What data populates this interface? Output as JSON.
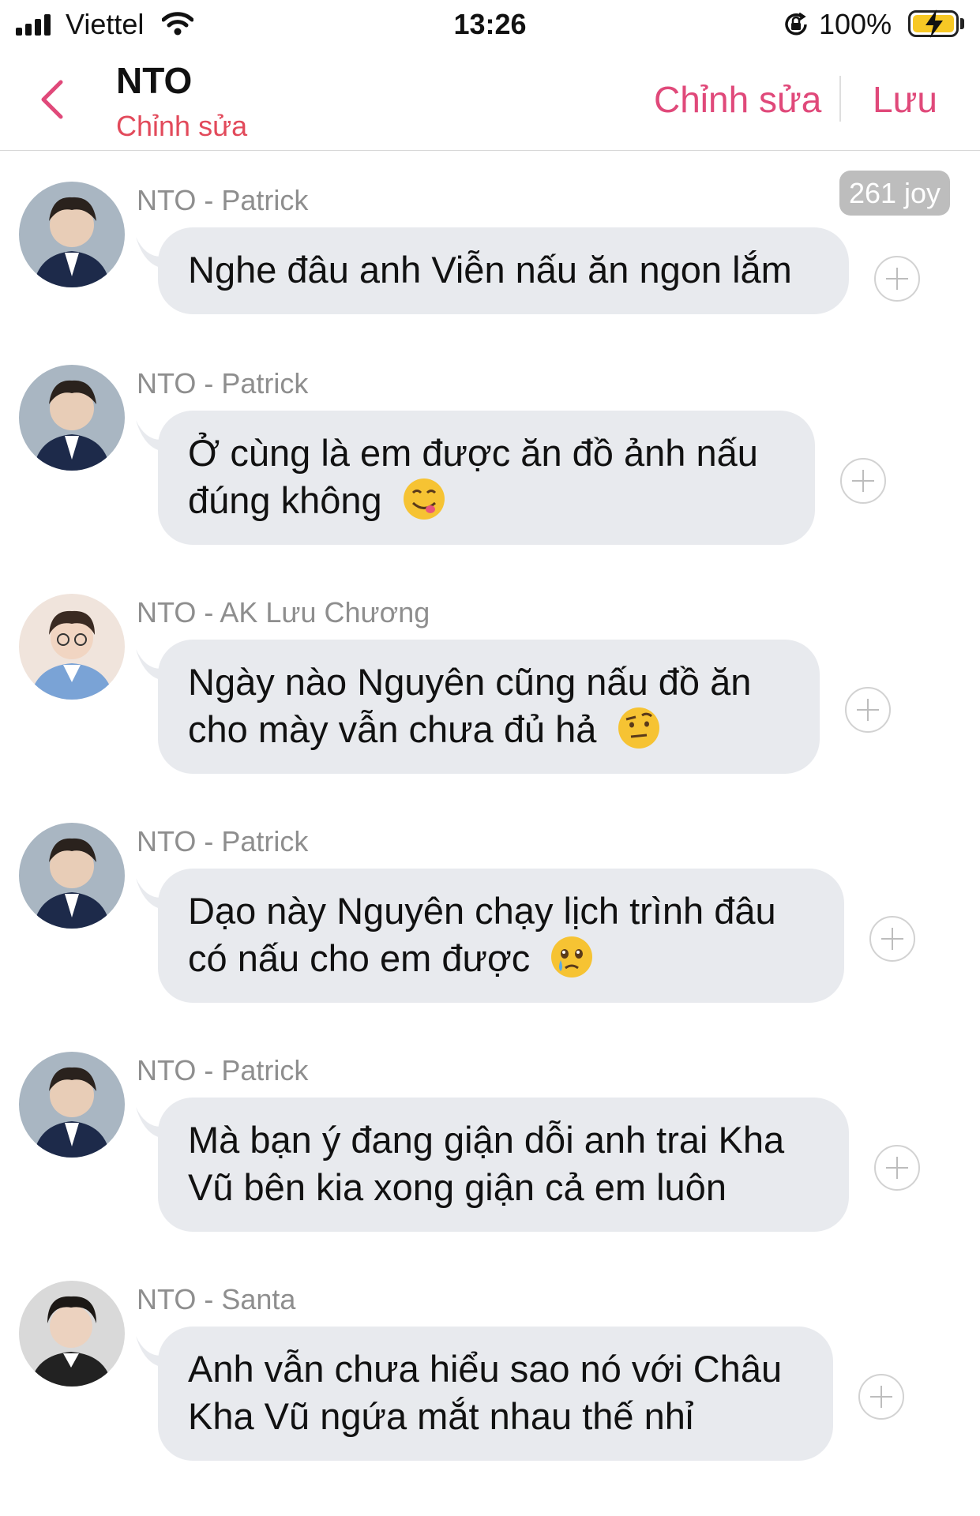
{
  "status_bar": {
    "carrier": "Viettel",
    "time": "13:26",
    "battery": "100%"
  },
  "header": {
    "title": "NTO",
    "subtitle": "Chỉnh sửa",
    "edit_label": "Chỉnh sửa",
    "save_label": "Lưu",
    "accent_color": "#e0497a"
  },
  "joy_badge": "261 joy",
  "messages": [
    {
      "sender": "NTO - Patrick",
      "text": "Nghe đâu anh Viễn nấu ăn ngon lắm",
      "emoji": ""
    },
    {
      "sender": "NTO - Patrick",
      "text": "Ở cùng là em được ăn đồ ảnh nấu đúng không",
      "emoji": "yum-face-icon"
    },
    {
      "sender": "NTO - AK Lưu Chương",
      "text": "Ngày nào Nguyên cũng nấu đồ ăn cho mày vẫn chưa đủ hả",
      "emoji": "raised-eyebrow-face-icon"
    },
    {
      "sender": "NTO - Patrick",
      "text": "Dạo này Nguyên chạy lịch trình đâu có nấu cho em được",
      "emoji": "holding-back-tears-face-icon"
    },
    {
      "sender": "NTO - Patrick",
      "text": "Mà bạn ý đang giận dỗi anh trai Kha Vũ bên kia xong giận cả em luôn",
      "emoji": ""
    },
    {
      "sender": "NTO - Santa",
      "text": "Anh vẫn chưa hiểu sao nó với Châu Kha Vũ ngứa mắt nhau thế nhỉ",
      "emoji": ""
    }
  ]
}
